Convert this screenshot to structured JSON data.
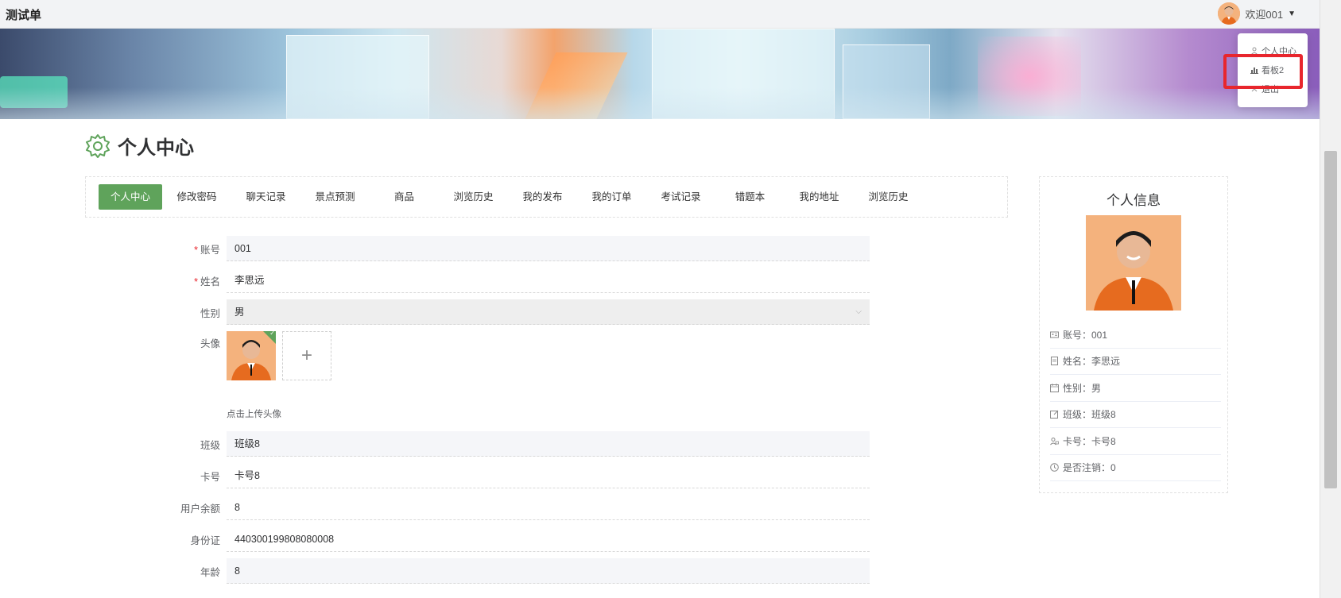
{
  "app": {
    "title": "测试单"
  },
  "header": {
    "welcome": "欢迎001"
  },
  "dropdown": {
    "items": [
      {
        "label": "个人中心",
        "icon": "user-icon"
      },
      {
        "label": "看板2",
        "icon": "chart-icon"
      },
      {
        "label": "退出",
        "icon": "close-icon"
      }
    ]
  },
  "page": {
    "title": "个人中心"
  },
  "tabs": [
    "个人中心",
    "修改密码",
    "聊天记录",
    "景点预测",
    "商品",
    "浏览历史",
    "我的发布",
    "我的订单",
    "考试记录",
    "错题本",
    "我的地址",
    "浏览历史"
  ],
  "form": {
    "account": {
      "label": "账号",
      "value": "001"
    },
    "name": {
      "label": "姓名",
      "value": "李思远"
    },
    "gender": {
      "label": "性别",
      "value": "男"
    },
    "avatar": {
      "label": "头像",
      "upload_icon": "+",
      "hint": "点击上传头像"
    },
    "class": {
      "label": "班级",
      "value": "班级8"
    },
    "card": {
      "label": "卡号",
      "value": "卡号8"
    },
    "balance": {
      "label": "用户余额",
      "value": "8"
    },
    "idcard": {
      "label": "身份证",
      "value": "440300199808080008"
    },
    "age": {
      "label": "年龄",
      "value": "8"
    }
  },
  "profile": {
    "title": "个人信息",
    "items": [
      {
        "icon": "id-card-icon",
        "text": "账号：001"
      },
      {
        "icon": "document-icon",
        "text": "姓名：李思远"
      },
      {
        "icon": "calendar-icon",
        "text": "性别：男"
      },
      {
        "icon": "edit-icon",
        "text": "班级：班级8"
      },
      {
        "icon": "user-card-icon",
        "text": "卡号：卡号8"
      },
      {
        "icon": "clock-icon",
        "text": "是否注销：0"
      }
    ]
  },
  "colors": {
    "accent": "#5fa35b",
    "highlight": "#e8262d"
  }
}
